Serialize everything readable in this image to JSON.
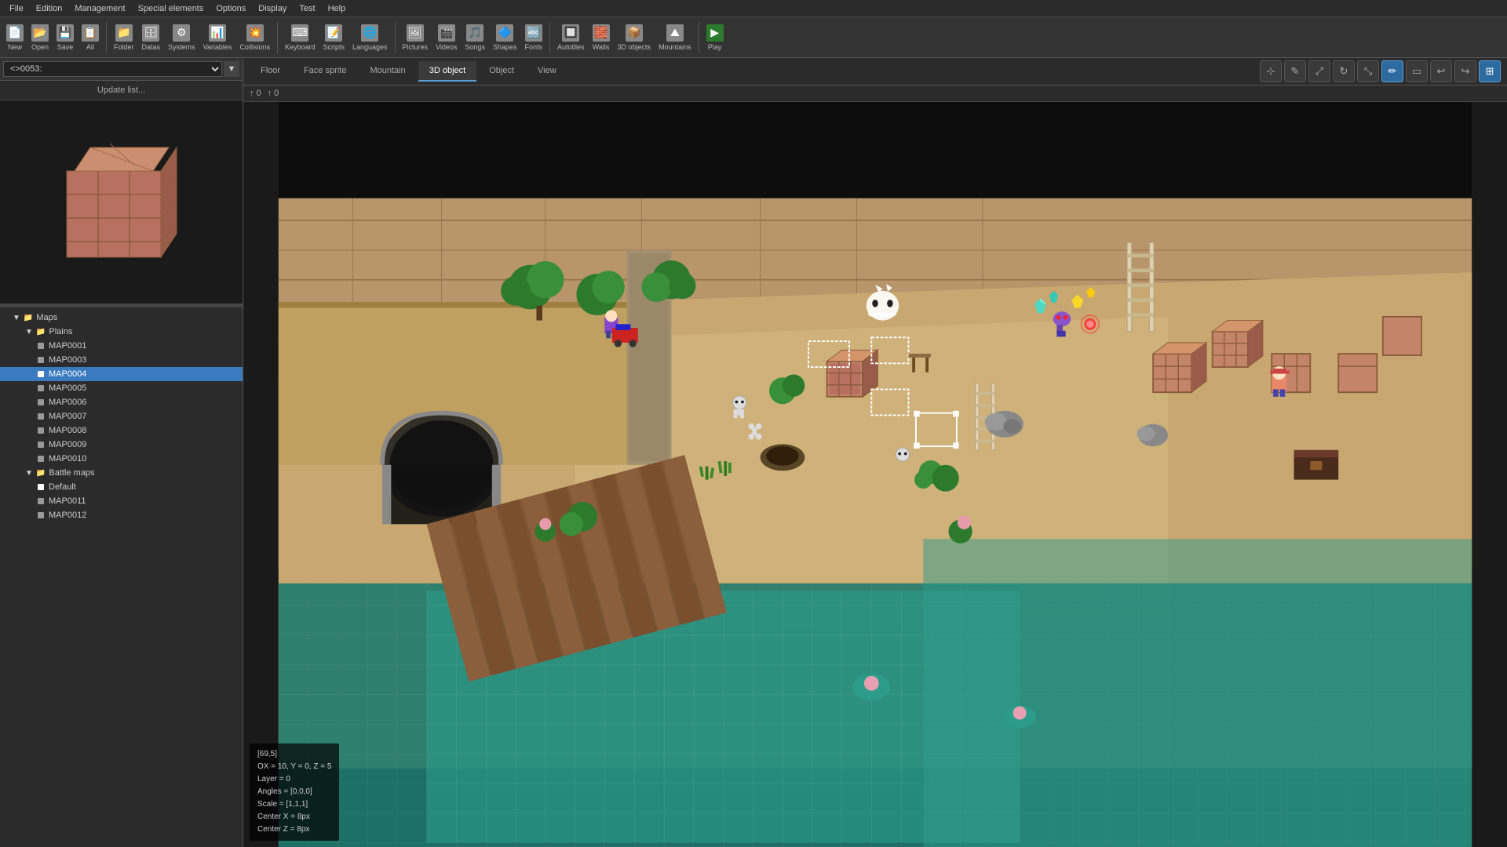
{
  "menubar": {
    "items": [
      "File",
      "Edition",
      "Management",
      "Special elements",
      "Options",
      "Display",
      "Test",
      "Help"
    ]
  },
  "toolbar": {
    "items": [
      {
        "id": "new",
        "label": "New",
        "icon": "📄"
      },
      {
        "id": "open",
        "label": "Open",
        "icon": "📂"
      },
      {
        "id": "save",
        "label": "Save",
        "icon": "💾"
      },
      {
        "id": "all",
        "label": "All",
        "icon": "📋"
      },
      {
        "id": "folder",
        "label": "Folder",
        "icon": "📁"
      },
      {
        "id": "datas",
        "label": "Datas",
        "icon": "🗄"
      },
      {
        "id": "systems",
        "label": "Systems",
        "icon": "⚙"
      },
      {
        "id": "variables",
        "label": "Variables",
        "icon": "📊"
      },
      {
        "id": "collisions",
        "label": "Collisions",
        "icon": "💥"
      },
      {
        "id": "keyboard",
        "label": "Keyboard",
        "icon": "⌨"
      },
      {
        "id": "scripts",
        "label": "Scripts",
        "icon": "📝"
      },
      {
        "id": "languages",
        "label": "Languages",
        "icon": "🌐"
      },
      {
        "id": "pictures",
        "label": "Pictures",
        "icon": "🖼"
      },
      {
        "id": "videos",
        "label": "Videos",
        "icon": "🎬"
      },
      {
        "id": "songs",
        "label": "Songs",
        "icon": "🎵"
      },
      {
        "id": "shapes",
        "label": "Shapes",
        "icon": "🔷"
      },
      {
        "id": "fonts",
        "label": "Fonts",
        "icon": "🔤"
      },
      {
        "id": "autotiles",
        "label": "Autotiles",
        "icon": "🔲"
      },
      {
        "id": "walls",
        "label": "Walls",
        "icon": "🧱"
      },
      {
        "id": "3dobjects",
        "label": "3D objects",
        "icon": "📦"
      },
      {
        "id": "mountains",
        "label": "Mountains",
        "icon": "⛰"
      },
      {
        "id": "play",
        "label": "Play",
        "icon": "▶"
      }
    ]
  },
  "leftpanel": {
    "map_selector_value": "<>0053:",
    "update_btn": "Update list...",
    "tree": {
      "maps_label": "Maps",
      "plains_label": "Plains",
      "items": [
        {
          "id": "MAP0001",
          "label": "MAP0001",
          "selected": false
        },
        {
          "id": "MAP0003",
          "label": "MAP0003",
          "selected": false
        },
        {
          "id": "MAP0004",
          "label": "MAP0004",
          "selected": true
        },
        {
          "id": "MAP0005",
          "label": "MAP0005",
          "selected": false
        },
        {
          "id": "MAP0006",
          "label": "MAP0006",
          "selected": false
        },
        {
          "id": "MAP0007",
          "label": "MAP0007",
          "selected": false
        },
        {
          "id": "MAP0008",
          "label": "MAP0008",
          "selected": false
        },
        {
          "id": "MAP0009",
          "label": "MAP0009",
          "selected": false
        },
        {
          "id": "MAP0010",
          "label": "MAP0010",
          "selected": false
        }
      ],
      "battle_maps_label": "Battle maps",
      "battle_items": [
        {
          "id": "Default",
          "label": "Default",
          "selected": false
        },
        {
          "id": "MAP0011",
          "label": "MAP0011",
          "selected": false
        },
        {
          "id": "MAP0012",
          "label": "MAP0012",
          "selected": false
        }
      ]
    }
  },
  "rightpanel": {
    "tabs": [
      "Floor",
      "Face sprite",
      "Mountain",
      "3D object",
      "Object",
      "View"
    ],
    "active_tab": "3D object",
    "coords": {
      "x_icon": "↑",
      "x_value": "0",
      "y_icon": "↑",
      "y_value": "0"
    },
    "tools": [
      {
        "id": "select",
        "icon": "⊹",
        "active": false
      },
      {
        "id": "pencil",
        "icon": "✎",
        "active": false
      },
      {
        "id": "move",
        "icon": "⤢",
        "active": false
      },
      {
        "id": "rotate",
        "icon": "↻",
        "active": false
      },
      {
        "id": "scale",
        "icon": "⤡",
        "active": false
      },
      {
        "id": "draw",
        "icon": "✏",
        "active": true
      },
      {
        "id": "eraser",
        "icon": "▭",
        "active": false
      },
      {
        "id": "undo",
        "icon": "↩",
        "active": false
      },
      {
        "id": "redo",
        "icon": "↪",
        "active": false
      },
      {
        "id": "fill",
        "icon": "⊞",
        "active": true
      }
    ]
  },
  "info_overlay": {
    "line1": "[69,5]",
    "line2": "OX = 10, Y = 0, Z = 5",
    "line3": "Layer = 0",
    "line4": "Angles = [0,0,0]",
    "line5": "Scale = [1,1,1]",
    "line6": "Center X = 8px",
    "line7": "Center Z = 8px"
  },
  "colors": {
    "accent": "#5a9fd4",
    "selected_bg": "#3a7bbf",
    "toolbar_bg": "#333333",
    "panel_bg": "#2b2b2b",
    "active_tool": "#2d6a9f"
  }
}
